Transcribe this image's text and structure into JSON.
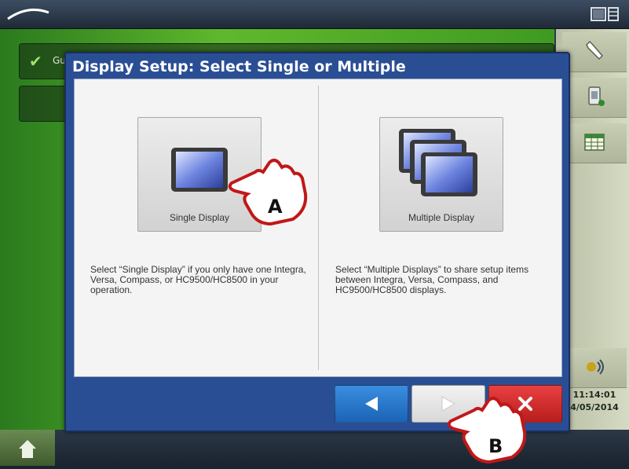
{
  "dialog": {
    "title": "Display Setup: Select Single or Multiple",
    "options": [
      {
        "label": "Single Display",
        "description": "Select “Single Display” if you only have one Integra, Versa, Compass, or HC9500/HC8500 in your operation."
      },
      {
        "label": "Multiple Display",
        "description": "Select “Multiple Displays” to share setup items between Integra, Versa, Compass, and HC9500/HC8500 displays."
      }
    ],
    "buttons": {
      "back_icon": "left-arrow-icon",
      "next_icon": "right-arrow-icon",
      "close_icon": "close-icon"
    }
  },
  "background": {
    "item_text": "Gu"
  },
  "status": {
    "time": "11:14:01",
    "date": "4/05/2014"
  },
  "callouts": {
    "a": "A",
    "b": "B"
  },
  "colors": {
    "dialog_blue": "#2a4e94",
    "back_button": "#1c63b4",
    "close_button": "#b81d1d",
    "workspace_green": "#5fb82c"
  }
}
